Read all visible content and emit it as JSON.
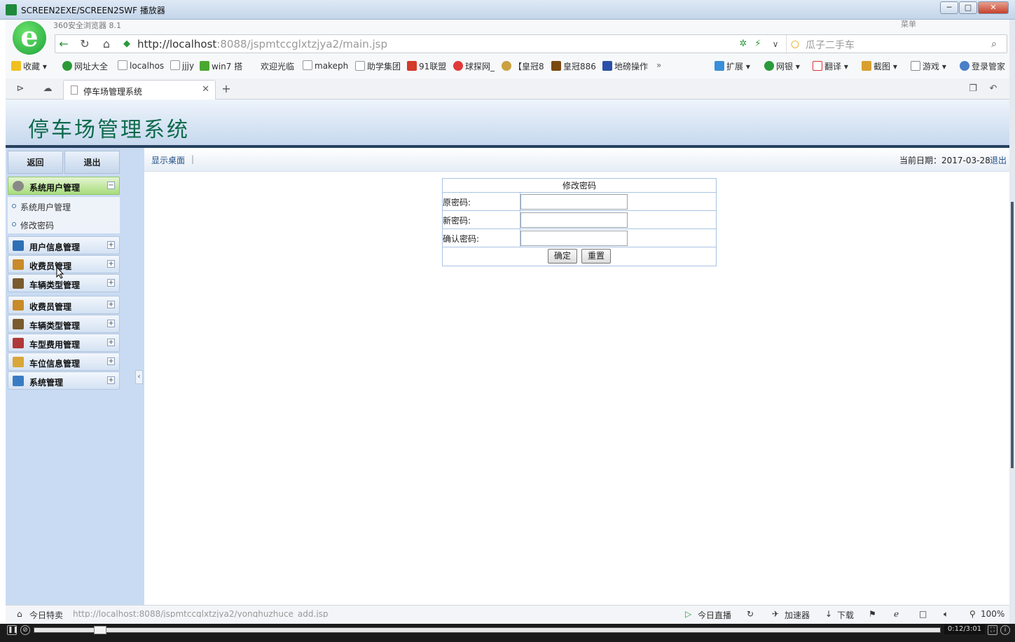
{
  "player": {
    "title": "SCREEN2EXE/SCREEN2SWF 播放器",
    "time": "0:12/3:01"
  },
  "browser": {
    "name": "360安全浏览器 8.1",
    "menu": "菜单",
    "url_host": "http://localhost",
    "url_rest": ":8088/jspmtccglxtzjya2/main.jsp",
    "search_placeholder": "瓜子二手车",
    "bookmarks": [
      "收藏",
      "网址大全",
      "localhos",
      "jjjy",
      "win7 搭",
      "欢迎光临",
      "makeph",
      "助学集团",
      "91联盟",
      "球探网_",
      "【皇冠8",
      "皇冠886",
      "地磅操作"
    ],
    "tools": [
      "扩展",
      "网银",
      "翻译",
      "截图",
      "游戏",
      "登录管家"
    ],
    "tab_label": "停车场管理系统",
    "status_left": "今日特卖",
    "status_url": "http://localhost:8088/jspmtccglxtzjya2/yonghuzhuce_add.jsp",
    "status_right": [
      "今日直播",
      "加速器",
      "下载"
    ],
    "zoom": "100%"
  },
  "app": {
    "title": "停车场管理系统",
    "back_label": "返回",
    "exit_label": "退出",
    "desk_link": "显示桌面",
    "date_label": "当前日期：2017-03-28",
    "logout_link": "退出"
  },
  "sidebar": {
    "active_group": "系统用户管理",
    "sub_items": [
      "系统用户管理",
      "修改密码"
    ],
    "groups": [
      "用户信息管理",
      "收费员管理",
      "车辆类型管理",
      "收费员管理",
      "车辆类型管理",
      "车型费用管理",
      "车位信息管理",
      "系统管理"
    ],
    "icon_colors": [
      "#2f6fb5",
      "#c98a2a",
      "#7a5a2f",
      "#c98a2a",
      "#7a5a2f",
      "#b03838",
      "#d9a63a",
      "#3a7cc4"
    ]
  },
  "form": {
    "title": "修改密码",
    "old_label": "原密码:",
    "new_label": "新密码:",
    "confirm_label": "确认密码:",
    "old_value": "",
    "new_value": "",
    "confirm_value": "",
    "submit_label": "确定",
    "reset_label": "重置"
  }
}
